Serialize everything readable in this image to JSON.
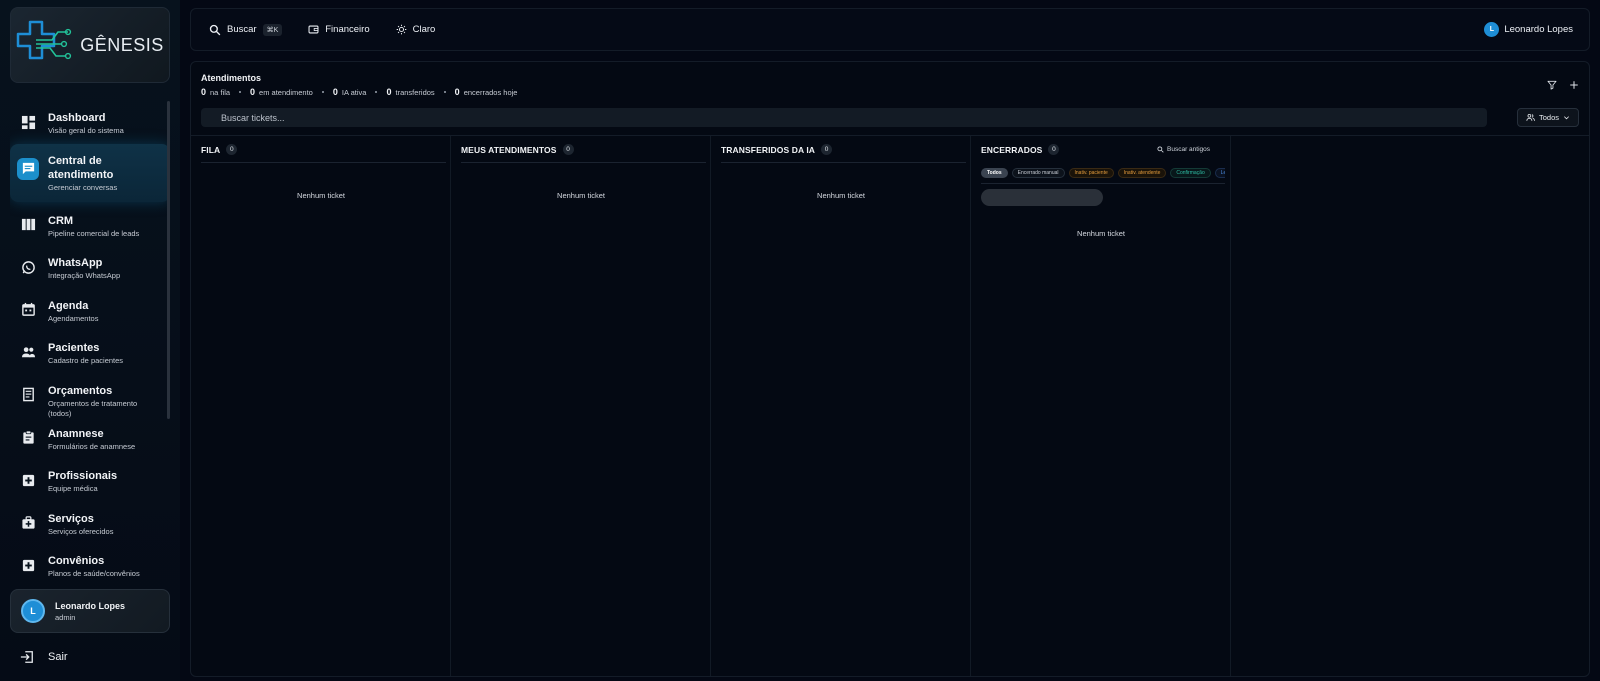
{
  "brand": {
    "name": "GÊNESIS"
  },
  "sidebar": {
    "items": [
      {
        "label": "Dashboard",
        "sub": "Visão geral do sistema",
        "icon": "dashboard-icon"
      },
      {
        "label": "Central de atendimento",
        "sub": "Gerenciar conversas",
        "icon": "chat-icon",
        "active": true
      },
      {
        "label": "CRM",
        "sub": "Pipeline comercial de leads",
        "icon": "kanban-icon"
      },
      {
        "label": "WhatsApp",
        "sub": "Integração WhatsApp",
        "icon": "whatsapp-icon"
      },
      {
        "label": "Agenda",
        "sub": "Agendamentos",
        "icon": "calendar-icon"
      },
      {
        "label": "Pacientes",
        "sub": "Cadastro de pacientes",
        "icon": "people-icon"
      },
      {
        "label": "Orçamentos",
        "sub": "Orçamentos de tratamento (todos)",
        "icon": "receipt-icon"
      },
      {
        "label": "Anamnese",
        "sub": "Formulários de anamnese",
        "icon": "clipboard-icon"
      },
      {
        "label": "Profissionais",
        "sub": "Equipe médica",
        "icon": "medical-cross-icon"
      },
      {
        "label": "Serviços",
        "sub": "Serviços oferecidos",
        "icon": "medical-bag-icon"
      },
      {
        "label": "Convênios",
        "sub": "Planos de saúde/convênios",
        "icon": "medical-plus-icon"
      }
    ],
    "user": {
      "initial": "L",
      "name": "Leonardo Lopes",
      "role": "admin"
    },
    "logout_label": "Sair"
  },
  "topbar": {
    "search_label": "Buscar",
    "search_shortcut": "⌘K",
    "finance_label": "Financeiro",
    "theme_label": "Claro",
    "user_initial": "L",
    "user_name": "Leonardo Lopes"
  },
  "main": {
    "title": "Atendimentos",
    "stats": [
      {
        "value": "0",
        "label": "na fila"
      },
      {
        "value": "0",
        "label": "em atendimento"
      },
      {
        "value": "0",
        "label": "IA ativa"
      },
      {
        "value": "0",
        "label": "transferidos"
      },
      {
        "value": "0",
        "label": "encerrados hoje"
      }
    ],
    "search_placeholder": "Buscar tickets...",
    "filter_select": "Todos"
  },
  "columns": [
    {
      "title": "FILA",
      "count": "0",
      "empty": "Nenhum ticket"
    },
    {
      "title": "MEUS ATENDIMENTOS",
      "count": "0",
      "empty": "Nenhum ticket"
    },
    {
      "title": "TRANSFERIDOS DA IA",
      "count": "0",
      "empty": "Nenhum ticket"
    },
    {
      "title": "ENCERRADOS",
      "count": "0",
      "empty": "Nenhum ticket",
      "search_old_label": "Buscar antigos",
      "chips": [
        "Todos",
        "Encerrado manual",
        "Inativ. paciente",
        "Inativ. atendente",
        "Confirmação",
        "Lembrete"
      ]
    }
  ],
  "colors": {
    "accent": "#1c8fcb",
    "chip_orange": "#e39b3c",
    "chip_teal": "#2fbfa6",
    "chip_blue": "#4c8ee6"
  }
}
